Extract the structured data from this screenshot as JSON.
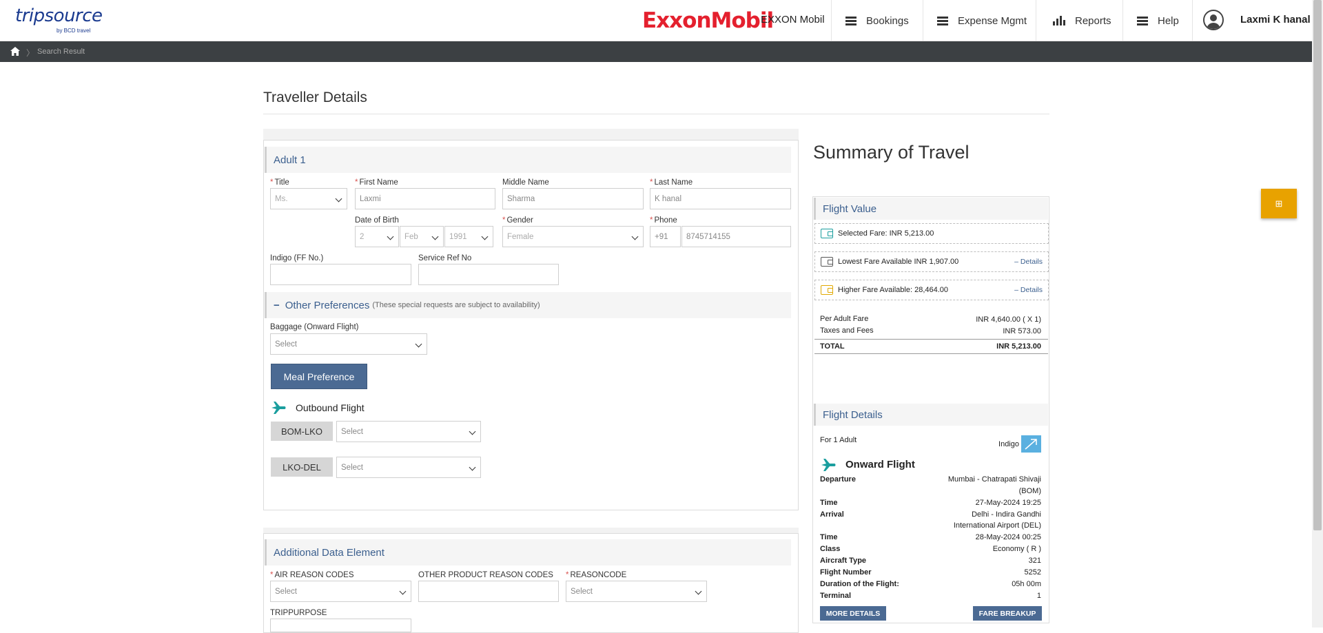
{
  "header": {
    "logo_text": "tripsource",
    "logo_sub": "by BCD travel",
    "brand": "ExxonMobil",
    "company": "EXXON Mobil",
    "nav": [
      {
        "label": "Bookings",
        "icon": "list-icon"
      },
      {
        "label": "Expense Mgmt",
        "icon": "list-icon"
      },
      {
        "label": "Reports",
        "icon": "bar-chart-icon"
      },
      {
        "label": "Help",
        "icon": "list-icon"
      }
    ],
    "user_name": "Laxmi K hanal"
  },
  "breadcrumb": {
    "current": "Search Result"
  },
  "page_title": "Traveller Details",
  "adult": {
    "heading": "Adult 1",
    "title_label": "Title",
    "title_value": "Ms.",
    "first_name_label": "First Name",
    "first_name_value": "Laxmi",
    "middle_name_label": "Middle Name",
    "middle_name_value": "Sharma",
    "last_name_label": "Last Name",
    "last_name_value": "K hanal",
    "dob_label": "Date of Birth",
    "dob_day": "2",
    "dob_month": "Feb",
    "dob_year": "1991",
    "gender_label": "Gender",
    "gender_value": "Female",
    "phone_label": "Phone",
    "phone_code": "+91",
    "phone_value": "8745714155",
    "ff_label": "Indigo (FF No.)",
    "ff_value": "",
    "service_ref_label": "Service Ref No",
    "service_ref_value": ""
  },
  "preferences": {
    "toggle": "−",
    "heading": "Other Preferences",
    "note": "(These special requests are subject to availability)",
    "baggage_label": "Baggage (Onward Flight)",
    "baggage_value": "Select",
    "meal_button": "Meal Preference",
    "outbound_label": "Outbound Flight",
    "segments": [
      {
        "route": "BOM-LKO",
        "value": "Select"
      },
      {
        "route": "LKO-DEL",
        "value": "Select"
      }
    ]
  },
  "additional": {
    "heading": "Additional Data Element",
    "air_reason_label": "AIR REASON CODES",
    "air_reason_value": "Select",
    "other_reason_label": "OTHER PRODUCT REASON CODES",
    "other_reason_value": "",
    "reasoncode_label": "REASONCODE",
    "reasoncode_value": "Select",
    "trip_purpose_label": "TRIPPURPOSE"
  },
  "summary": {
    "title": "Summary of Travel",
    "fab_icon": "⊞",
    "flight_value_heading": "Flight Value",
    "selected_fare": "Selected Fare: INR 5,213.00",
    "lowest_fare": "Lowest Fare Available INR 1,907.00",
    "higher_fare": "Higher Fare Available: 28,464.00",
    "details_link": "– Details",
    "per_adult_label": "Per Adult Fare",
    "per_adult_value": "INR 4,640.00 ( X 1)",
    "taxes_label": "Taxes and Fees",
    "taxes_value": "INR 573.00",
    "total_label": "TOTAL",
    "total_value": "INR 5,213.00",
    "colors": {
      "teal": "#1a9e9e",
      "gold": "#e0a800"
    }
  },
  "flight_details": {
    "heading": "Flight Details",
    "for_adult": "For 1 Adult",
    "airline": "Indigo",
    "onward_label": "Onward Flight",
    "rows": [
      {
        "label": "Departure",
        "value_lines": [
          "Mumbai - Chatrapati Shivaji",
          "(BOM)"
        ]
      },
      {
        "label": "Time",
        "value_lines": [
          "27-May-2024 19:25"
        ]
      },
      {
        "label": "Arrival",
        "value_lines": [
          "Delhi - Indira Gandhi",
          "International Airport (DEL)"
        ]
      },
      {
        "label": "Time",
        "value_lines": [
          "28-May-2024 00:25"
        ]
      },
      {
        "label": "Class",
        "value_lines": [
          "Economy ( R )"
        ]
      },
      {
        "label": "Aircraft Type",
        "value_lines": [
          "321"
        ]
      },
      {
        "label": "Flight Number",
        "value_lines": [
          "5252"
        ]
      },
      {
        "label": "Duration of the Flight:",
        "value_lines": [
          "05h 00m"
        ]
      },
      {
        "label": "Terminal",
        "value_lines": [
          "1"
        ]
      }
    ],
    "more_details_button": "MORE DETAILS",
    "fare_breakup_button": "FARE BREAKUP"
  }
}
